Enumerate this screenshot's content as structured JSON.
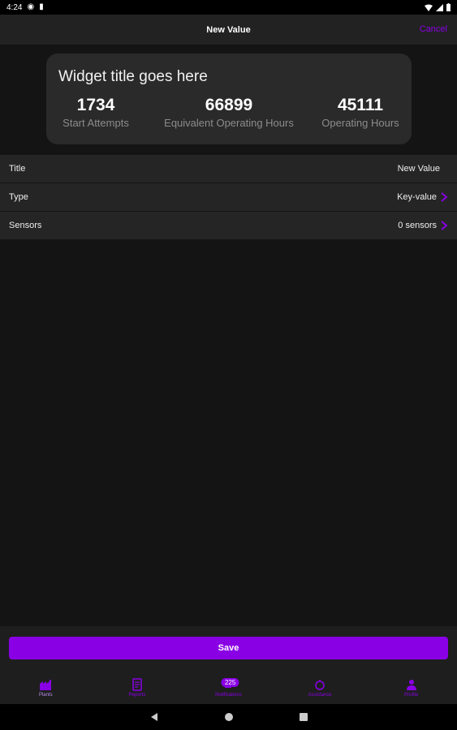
{
  "status_bar": {
    "time": "4:24"
  },
  "header": {
    "title": "New Value",
    "cancel_label": "Cancel"
  },
  "widget": {
    "title": "Widget title goes here",
    "items": [
      {
        "value": "1734",
        "label": "Start Attempts"
      },
      {
        "value": "66899",
        "label": "Equivalent Operating Hours"
      },
      {
        "value": "45111",
        "label": "Operating Hours"
      }
    ]
  },
  "settings": {
    "title_row": {
      "label": "Title",
      "value": "New Value"
    },
    "type_row": {
      "label": "Type",
      "value": "Key-value"
    },
    "sensors_row": {
      "label": "Sensors",
      "value": "0 sensors"
    }
  },
  "save_label": "Save",
  "tabs": [
    {
      "label": "Plants",
      "icon": "plants-icon"
    },
    {
      "label": "Reports",
      "icon": "reports-icon"
    },
    {
      "label": "Notifications",
      "icon": "notifications-icon",
      "badge": "225"
    },
    {
      "label": "Assistance",
      "icon": "assistance-icon"
    },
    {
      "label": "Profile",
      "icon": "profile-icon"
    }
  ],
  "colors": {
    "accent": "#8a00e5",
    "background": "#141414",
    "surface": "#252525",
    "card": "#2a2a2a"
  }
}
